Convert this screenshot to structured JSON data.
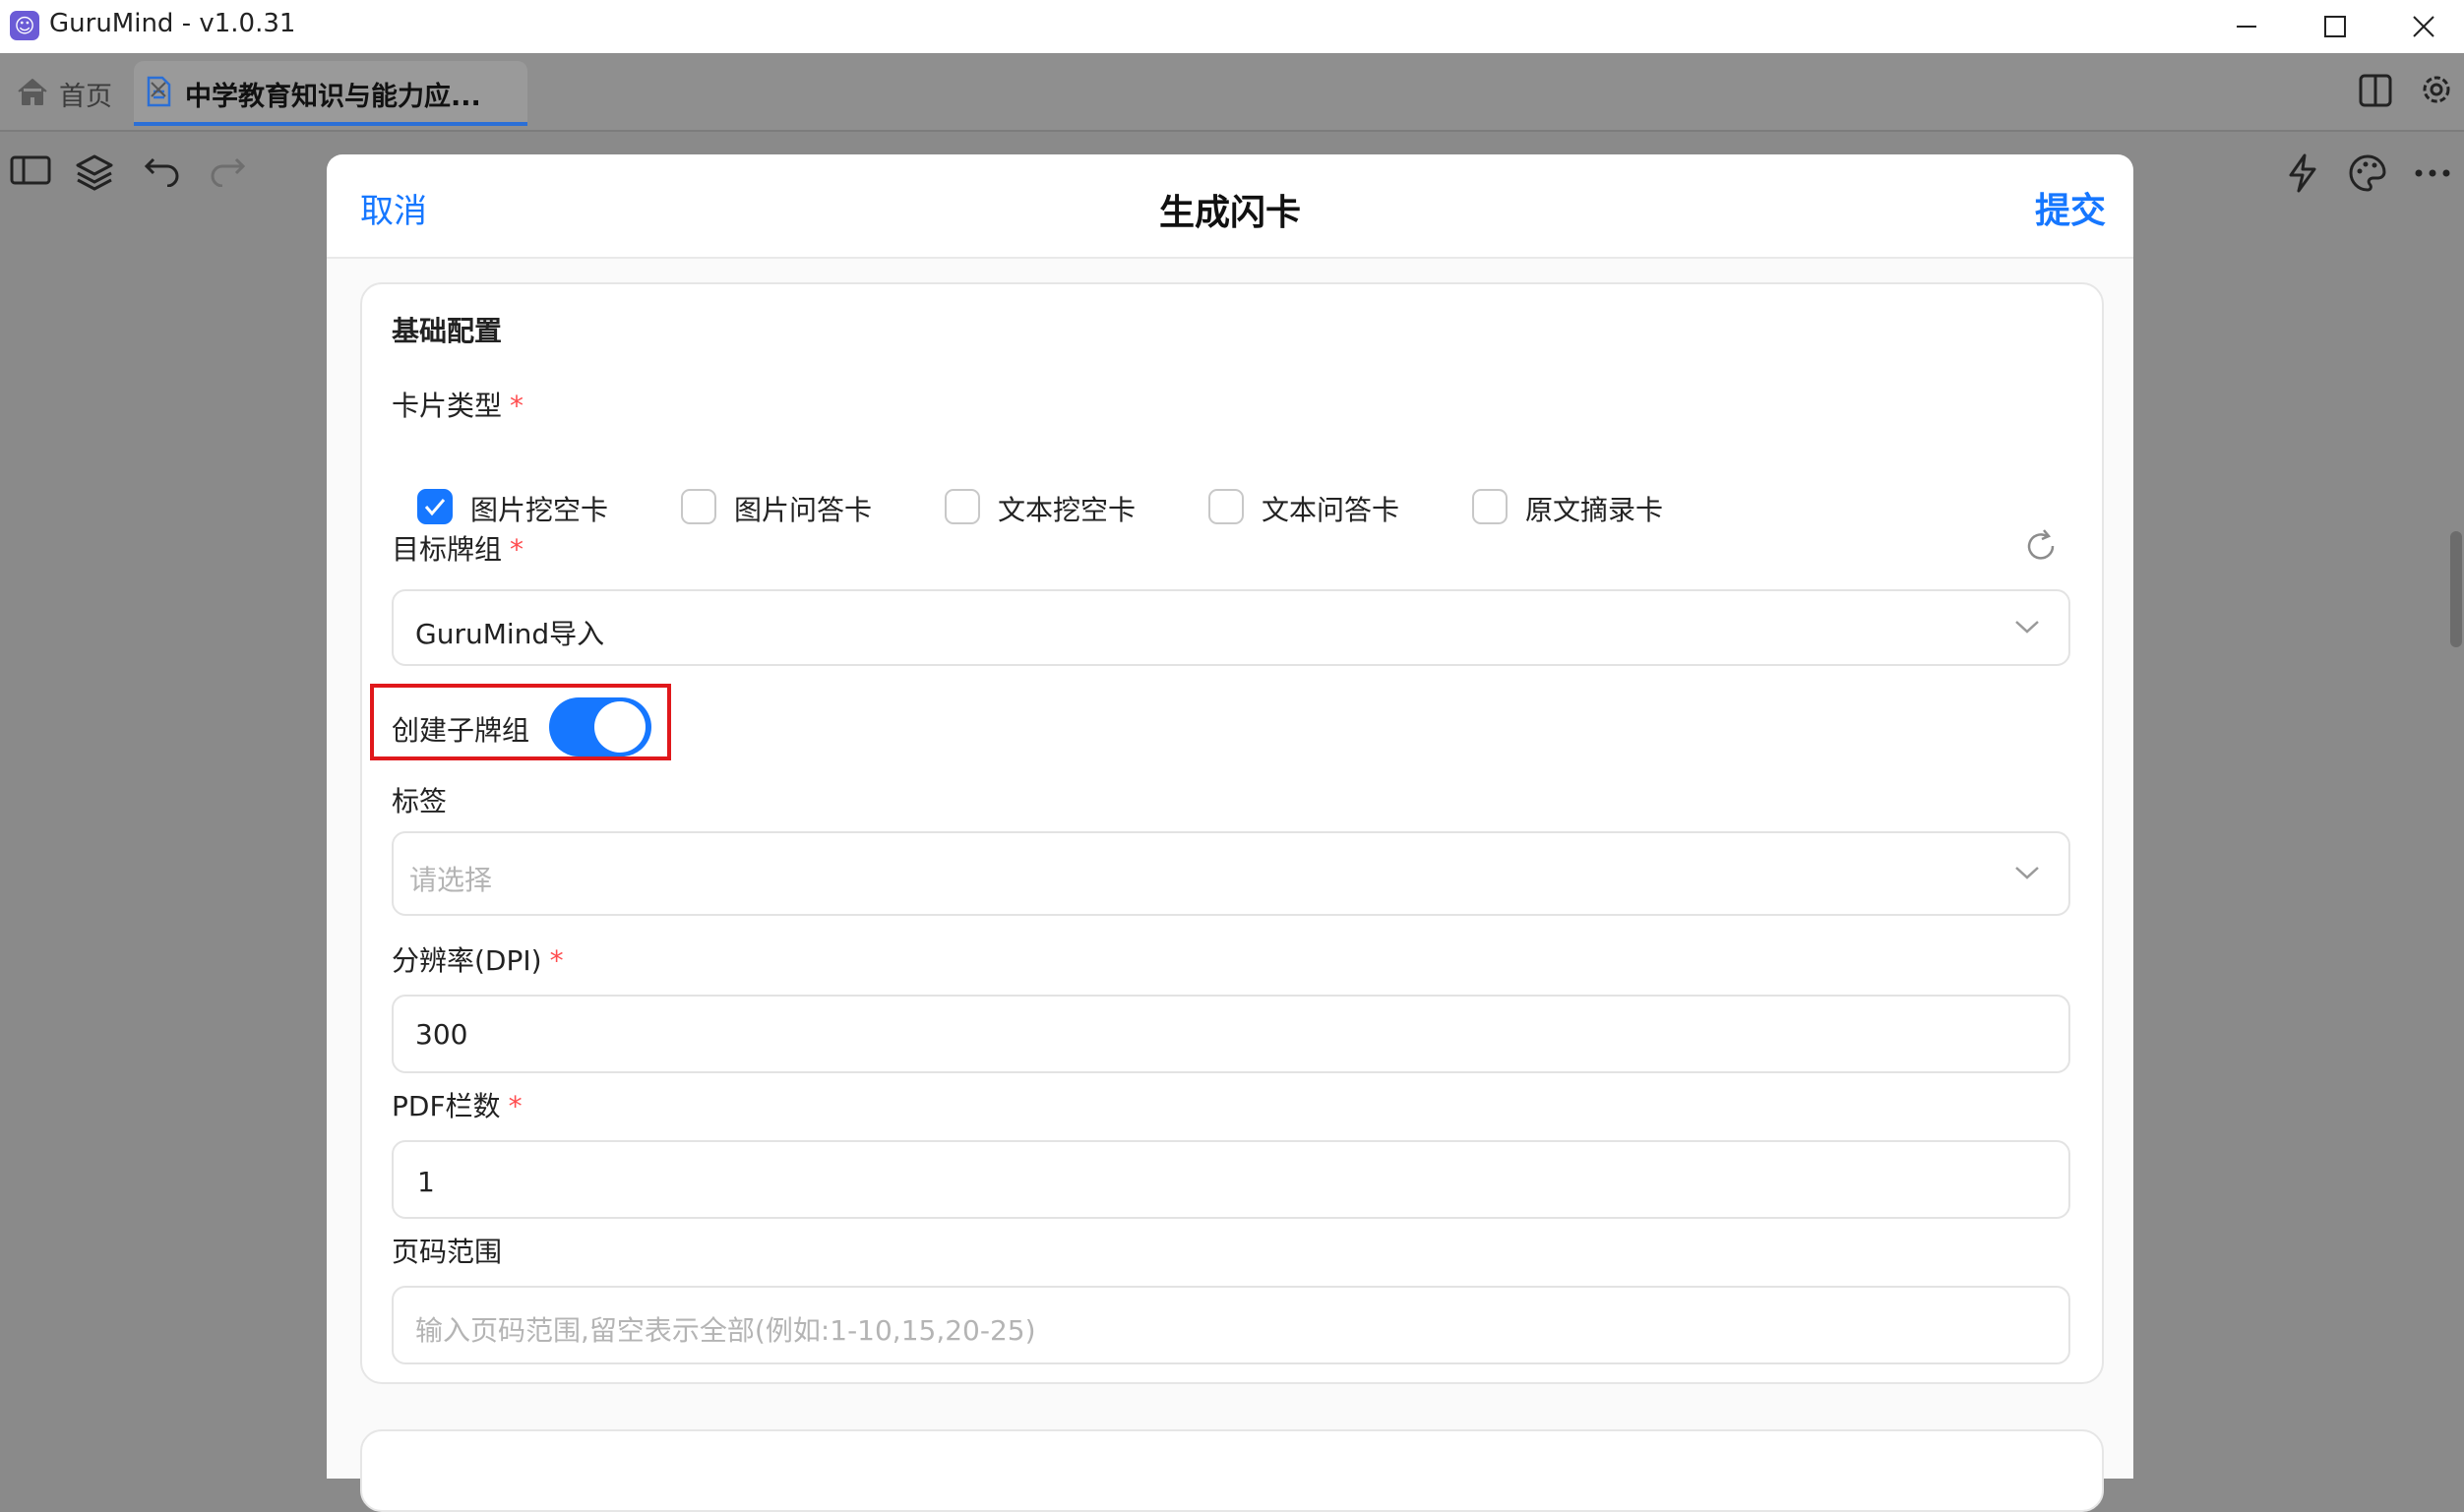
{
  "window": {
    "title": "GuruMind - v1.0.31",
    "controls": [
      "minimize",
      "maximize",
      "close"
    ]
  },
  "tabs": {
    "home_label": "首页",
    "active_label": "中学教育知识与能力应...",
    "active_icon": "document-icon"
  },
  "toolbar": {
    "left_icons": [
      "sidebar-icon",
      "layers-icon",
      "undo-icon",
      "redo-icon"
    ],
    "right_icons": [
      "lightning-icon",
      "palette-icon",
      "more-icon"
    ]
  },
  "modal": {
    "cancel_label": "取消",
    "title": "生成闪卡",
    "submit_label": "提交",
    "accent_color": "#1677ff",
    "section_title": "基础配置",
    "card_type": {
      "label": "卡片类型",
      "required_mark": "*",
      "options": [
        {
          "label": "图片挖空卡",
          "checked": true
        },
        {
          "label": "图片问答卡",
          "checked": false
        },
        {
          "label": "文本挖空卡",
          "checked": false
        },
        {
          "label": "文本问答卡",
          "checked": false
        },
        {
          "label": "原文摘录卡",
          "checked": false
        }
      ]
    },
    "target_deck": {
      "label": "目标牌组",
      "required_mark": "*",
      "value": "GuruMind导入"
    },
    "create_subdeck": {
      "label": "创建子牌组",
      "enabled": true
    },
    "tags": {
      "label": "标签",
      "placeholder": "请选择"
    },
    "dpi": {
      "label": "分辨率(DPI)",
      "required_mark": "*",
      "value": "300"
    },
    "pdf_columns": {
      "label": "PDF栏数",
      "required_mark": "*",
      "value": "1"
    },
    "page_range": {
      "label": "页码范围",
      "placeholder": "输入页码范围,留空表示全部(例如:1-10,15,20-25)"
    }
  }
}
